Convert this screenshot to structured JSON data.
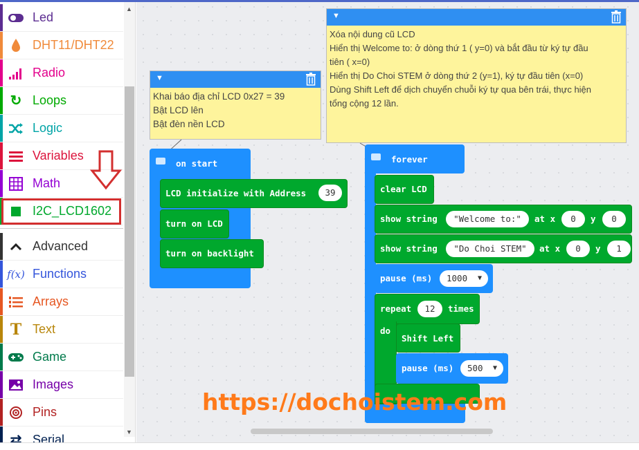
{
  "toolbox": {
    "items": [
      {
        "label": "Led",
        "icon": "toggle-icon",
        "color": "#5c2d91"
      },
      {
        "label": "DHT11/DHT22",
        "icon": "droplet-icon",
        "color": "#f08a3a"
      },
      {
        "label": "Radio",
        "icon": "signal-bars-icon",
        "color": "#e3008c"
      },
      {
        "label": "Loops",
        "icon": "loop-arrow-icon",
        "color": "#00aa00"
      },
      {
        "label": "Logic",
        "icon": "shuffle-icon",
        "color": "#00a4a6"
      },
      {
        "label": "Variables",
        "icon": "list-lines-icon",
        "color": "#dc143c"
      },
      {
        "label": "Math",
        "icon": "calculator-icon",
        "color": "#9400d3"
      },
      {
        "label": "I2C_LCD1602",
        "icon": "square-icon",
        "color": "#00a82d"
      },
      {
        "label": "Advanced",
        "icon": "chevron-up-icon",
        "color": "#333333"
      },
      {
        "label": "Functions",
        "icon": "function-fx-icon",
        "color": "#3455db"
      },
      {
        "label": "Arrays",
        "icon": "numbered-list-icon",
        "color": "#e65722"
      },
      {
        "label": "Text",
        "icon": "text-t-icon",
        "color": "#b8860b"
      },
      {
        "label": "Game",
        "icon": "gamepad-icon",
        "color": "#007a4b"
      },
      {
        "label": "Images",
        "icon": "image-icon",
        "color": "#7600a8"
      },
      {
        "label": "Pins",
        "icon": "target-icon",
        "color": "#b22222"
      },
      {
        "label": "Serial",
        "icon": "serial-icon",
        "color": "#002050"
      }
    ]
  },
  "comments": {
    "left": {
      "lines": [
        "Khai báo địa chỉ LCD 0x27 = 39",
        "Bật LCD lên",
        "Bật đèn nền LCD"
      ]
    },
    "right": {
      "lines": [
        "Xóa nội dung cũ LCD",
        "Hiển thị Welcome to: ở dòng thứ 1 ( y=0) và bắt đầu từ ký tự đầu",
        "tiên ( x=0)",
        "Hiển thị Do Choi STEM ở dòng thứ 2 (y=1), ký tự đầu tiên (x=0)",
        "Dùng Shift Left để dịch chuyển chuỗi ký tự qua bên trái, thực hiện",
        "tổng cộng 12 lần."
      ]
    }
  },
  "on_start": {
    "title": "on start",
    "lcd_init": "LCD initialize with Address",
    "address": "39",
    "turn_on_lcd": "turn on LCD",
    "turn_on_backlight": "turn on backlight"
  },
  "forever": {
    "title": "forever",
    "clear_lcd": "clear LCD",
    "show1": {
      "label": "show string",
      "text": "\"Welcome to:\"",
      "at_x": "at x",
      "x": "0",
      "y_label": "y",
      "y": "0"
    },
    "show2": {
      "label": "show string",
      "text": "\"Do Choi STEM\"",
      "at_x": "at x",
      "x": "0",
      "y_label": "y",
      "y": "1"
    },
    "pause1": {
      "label": "pause (ms)",
      "value": "1000"
    },
    "repeat": {
      "label": "repeat",
      "count": "12",
      "times": "times",
      "do": "do"
    },
    "shift_left": "Shift Left",
    "pause2": {
      "label": "pause (ms)",
      "value": "500"
    }
  },
  "watermark": "https://dochoistem.com",
  "colors": {
    "blue_block": "#1e90ff",
    "green_block": "#00a82d",
    "comment_bg": "#fef49c",
    "watermark": "#ff7a1a",
    "highlight": "#d32f2f"
  }
}
